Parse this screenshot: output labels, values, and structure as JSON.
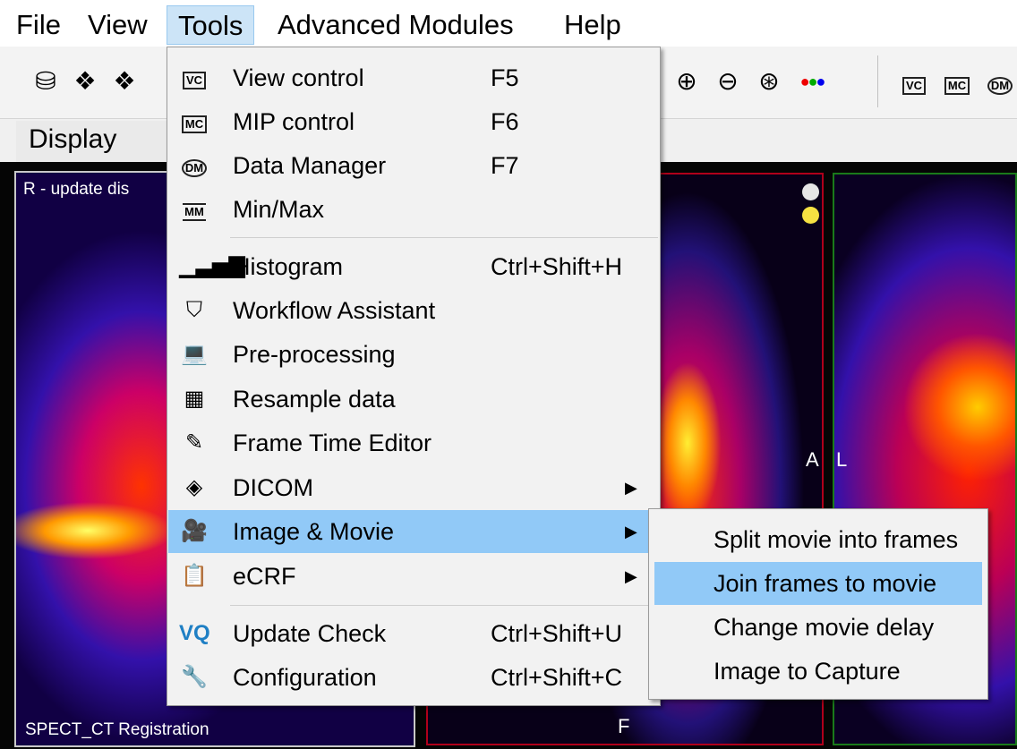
{
  "menubar": {
    "items": [
      "File",
      "View",
      "Tools",
      "Advanced Modules",
      "Help"
    ],
    "active": "Tools"
  },
  "toolbar": {
    "left_icons": [
      "database-icon",
      "layers-1-icon",
      "layers-add-icon"
    ],
    "right_icons": [
      "zoom-in-icon",
      "zoom-out-icon",
      "zoom-auto-icon",
      "color-palette-icon"
    ],
    "far_right_icons": [
      "view-control-icon",
      "mip-control-icon",
      "data-manager-icon"
    ]
  },
  "display_tab": {
    "label": "Display"
  },
  "viewports": {
    "left_overlay_text": "R - update dis",
    "left_bottom_text": "SPECT_CT Registration",
    "middle_label_a": "A",
    "middle_label_l": "L",
    "middle_bottom_label": "F",
    "dot_colors": [
      "#e6e6e6",
      "#f5e142"
    ]
  },
  "tools_menu": {
    "items": [
      {
        "label": "View control",
        "shortcut": "F5",
        "icon": "view-control-icon",
        "icon_text": "VC"
      },
      {
        "label": "MIP control",
        "shortcut": "F6",
        "icon": "mip-control-icon",
        "icon_text": "MC"
      },
      {
        "label": "Data Manager",
        "shortcut": "F7",
        "icon": "data-manager-icon",
        "icon_text": "DM"
      },
      {
        "label": "Min/Max",
        "shortcut": "",
        "icon": "min-max-icon",
        "icon_text": "MM"
      },
      {
        "label": "Histogram",
        "shortcut": "Ctrl+Shift+H",
        "icon": "histogram-icon",
        "icon_text": ""
      },
      {
        "label": "Workflow Assistant",
        "shortcut": "",
        "icon": "workflow-assistant-icon",
        "icon_text": ""
      },
      {
        "label": "Pre-processing",
        "shortcut": "",
        "icon": "laptop-icon",
        "icon_text": ""
      },
      {
        "label": "Resample data",
        "shortcut": "",
        "icon": "grid-icon",
        "icon_text": ""
      },
      {
        "label": "Frame Time Editor",
        "shortcut": "",
        "icon": "pen-icon",
        "icon_text": ""
      },
      {
        "label": "DICOM",
        "shortcut": "",
        "icon": "dicom-icon",
        "icon_text": ""
      },
      {
        "label": "Image & Movie",
        "shortcut": "",
        "icon": "movie-camera-icon",
        "icon_text": ""
      },
      {
        "label": "eCRF",
        "shortcut": "",
        "icon": "clipboard-icon",
        "icon_text": ""
      },
      {
        "label": "Update Check",
        "shortcut": "Ctrl+Shift+U",
        "icon": "update-check-icon",
        "icon_text": ""
      },
      {
        "label": "Configuration",
        "shortcut": "Ctrl+Shift+C",
        "icon": "wrench-icon",
        "icon_text": ""
      }
    ],
    "highlighted": "Image & Movie"
  },
  "image_movie_submenu": {
    "items": [
      "Split movie into frames",
      "Join frames to movie",
      "Change movie delay",
      "Image to Capture"
    ],
    "highlighted": "Join frames to movie"
  },
  "colors": {
    "menu_highlight": "#91c9f7",
    "menubar_active": "#cce4f7",
    "viewport_red_border": "#b0001a",
    "viewport_green_border": "#1a7a1a"
  }
}
